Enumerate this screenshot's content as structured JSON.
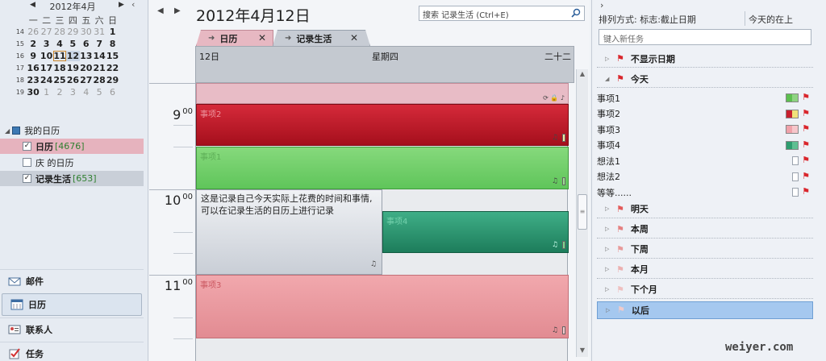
{
  "mini_calendar": {
    "title": "2012年4月",
    "weekdays": [
      "一",
      "二",
      "三",
      "四",
      "五",
      "六",
      "日"
    ],
    "weeks": [
      {
        "wk": "14",
        "days": [
          {
            "d": "26",
            "dim": true
          },
          {
            "d": "27",
            "dim": true
          },
          {
            "d": "28",
            "dim": true
          },
          {
            "d": "29",
            "dim": true
          },
          {
            "d": "30",
            "dim": true
          },
          {
            "d": "31",
            "dim": true
          },
          {
            "d": "1",
            "bold": true
          }
        ]
      },
      {
        "wk": "15",
        "days": [
          {
            "d": "2",
            "bold": true
          },
          {
            "d": "3",
            "bold": true
          },
          {
            "d": "4",
            "bold": true
          },
          {
            "d": "5",
            "bold": true
          },
          {
            "d": "6",
            "bold": true
          },
          {
            "d": "7",
            "bold": true
          },
          {
            "d": "8",
            "bold": true
          }
        ]
      },
      {
        "wk": "16",
        "days": [
          {
            "d": "9",
            "bold": true
          },
          {
            "d": "10",
            "bold": true
          },
          {
            "d": "11",
            "bold": true,
            "today": true
          },
          {
            "d": "12",
            "bold": true,
            "selected": true
          },
          {
            "d": "13",
            "bold": true
          },
          {
            "d": "14",
            "bold": true
          },
          {
            "d": "15",
            "bold": true
          }
        ]
      },
      {
        "wk": "17",
        "days": [
          {
            "d": "16",
            "bold": true
          },
          {
            "d": "17",
            "bold": true
          },
          {
            "d": "18",
            "bold": true
          },
          {
            "d": "19",
            "bold": true
          },
          {
            "d": "20",
            "bold": true
          },
          {
            "d": "21",
            "bold": true
          },
          {
            "d": "22",
            "bold": true
          }
        ]
      },
      {
        "wk": "18",
        "days": [
          {
            "d": "23",
            "bold": true
          },
          {
            "d": "24",
            "bold": true
          },
          {
            "d": "25",
            "bold": true
          },
          {
            "d": "26",
            "bold": true
          },
          {
            "d": "27",
            "bold": true
          },
          {
            "d": "28",
            "bold": true
          },
          {
            "d": "29",
            "bold": true
          }
        ]
      },
      {
        "wk": "19",
        "days": [
          {
            "d": "30",
            "bold": true
          },
          {
            "d": "1",
            "dim": true
          },
          {
            "d": "2",
            "dim": true
          },
          {
            "d": "3",
            "dim": true
          },
          {
            "d": "4",
            "dim": true
          },
          {
            "d": "5",
            "dim": true
          },
          {
            "d": "6",
            "dim": true
          }
        ]
      }
    ]
  },
  "calendars": {
    "group_label": "我的日历",
    "items": [
      {
        "label": "日历",
        "count": "[4676]",
        "checked": true
      },
      {
        "label": "庆 的日历",
        "count": "",
        "checked": false
      },
      {
        "label": "记录生活",
        "count": "[653]",
        "checked": true
      }
    ]
  },
  "nav": {
    "mail": "邮件",
    "calendar": "日历",
    "contacts": "联系人",
    "tasks": "任务"
  },
  "center": {
    "date_title": "2012年4月12日",
    "search_placeholder": "搜索 记录生活 (Ctrl+E)",
    "tabs": [
      "日历",
      "记录生活"
    ],
    "day_header": {
      "date": "12日",
      "dow": "星期四",
      "week": "二十二"
    },
    "hours": [
      {
        "h": "9",
        "m": "00"
      },
      {
        "h": "10",
        "m": "00"
      },
      {
        "h": "11",
        "m": "00"
      }
    ],
    "events": {
      "e2": "事项2",
      "e1": "事项1",
      "note": "这是记录自己今天实际上花费的时间和事情,可以在记录生活的日历上进行记录",
      "e4": "事项4",
      "e3": "事项3"
    }
  },
  "todo": {
    "sort_label": "排列方式: 标志:截止日期",
    "sort_order": "今天的在上",
    "new_task_placeholder": "键入新任务",
    "groups": {
      "no_date": "不显示日期",
      "today": "今天",
      "tomorrow": "明天",
      "this_week": "本周",
      "next_week": "下周",
      "this_month": "本月",
      "next_month": "下个月",
      "later": "以后"
    },
    "today_items": [
      {
        "label": "事项1",
        "c1": "#5cbf4f",
        "c2": "#8ed381"
      },
      {
        "label": "事项2",
        "c1": "#c8202e",
        "c2": "#f1e27a"
      },
      {
        "label": "事项3",
        "c1": "#f0a2aa",
        "c2": "#f6c6cb"
      },
      {
        "label": "事项4",
        "c1": "#2e9d6f",
        "c2": "#5fbf92"
      },
      {
        "label": "想法1"
      },
      {
        "label": "想法2"
      },
      {
        "label": "等等......"
      }
    ]
  },
  "colors": {
    "flag_red": "#d9262c",
    "selection": "#a5c8ef"
  },
  "watermark": "weiyer.com"
}
